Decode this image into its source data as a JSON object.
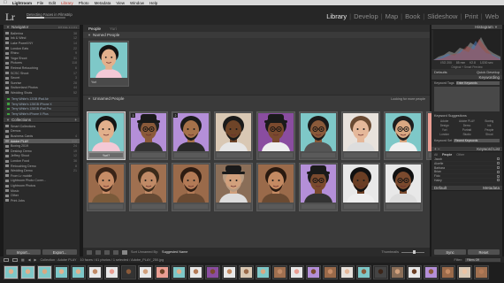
{
  "menubar": {
    "app": "Lightroom",
    "items": [
      "File",
      "Edit",
      "Library",
      "Photo",
      "Metadata",
      "View",
      "Window",
      "Help"
    ],
    "highlight_color": "#c0392b"
  },
  "identity": {
    "logo": "Lr",
    "status": "Detecting Faces in Filmstrip",
    "progress_fraction": 0.45
  },
  "modules": [
    "Library",
    "Develop",
    "Map",
    "Book",
    "Slideshow",
    "Print",
    "Web"
  ],
  "active_module": "Library",
  "left_panel": {
    "navigator_title": "Navigator",
    "navigator_options": "FIT FILL 1:1 3:1",
    "folders": [
      {
        "name": "Ballerina",
        "count": "38"
      },
      {
        "name": "Ink & Wind",
        "count": "12"
      },
      {
        "name": "Lake Powell NY",
        "count": "14"
      },
      {
        "name": "London Eats",
        "count": "22"
      },
      {
        "name": "Rhino",
        "count": "9"
      },
      {
        "name": "Yoga Shoot",
        "count": "31"
      },
      {
        "name": "Pictures",
        "count": "118"
      },
      {
        "name": "Retreat Retouching",
        "count": "6"
      },
      {
        "name": "SCSC Shoot",
        "count": "17"
      },
      {
        "name": "Secret",
        "count": "3"
      },
      {
        "name": "Sunrise",
        "count": "28"
      },
      {
        "name": "Switzerland Photos",
        "count": "44"
      },
      {
        "name": "Wedding Shots",
        "count": "52"
      }
    ],
    "volumes": [
      "Terry White's 12GB iPad Air",
      "Terry White's 128GB iPhone X",
      "Terry White's 128GB iPad Pro",
      "Terry White's iPhone X Plus"
    ],
    "collections_title": "Collections",
    "collections": [
      {
        "name": "Smart Collections",
        "count": "",
        "selected": false
      },
      {
        "name": "Demos",
        "count": "",
        "selected": false
      },
      {
        "name": "Business Cards",
        "count": "4",
        "selected": false
      },
      {
        "name": "Adobe PLAY",
        "count": "310",
        "selected": true
      },
      {
        "name": "Boxing 2019",
        "count": "24",
        "selected": false
      },
      {
        "name": "Desktop Demo",
        "count": "19",
        "selected": false
      },
      {
        "name": "Jeffrey Shoot",
        "count": "12",
        "selected": false
      },
      {
        "name": "London Food",
        "count": "36",
        "selected": false
      },
      {
        "name": "Retouching Demo",
        "count": "8",
        "selected": false
      },
      {
        "name": "Wedding Demo",
        "count": "21",
        "selected": false
      },
      {
        "name": "From Lr mobile",
        "count": "",
        "selected": false
      },
      {
        "name": "Lightroom Photo Cover...",
        "count": "",
        "selected": false
      },
      {
        "name": "Lightroom Photos",
        "count": "",
        "selected": false
      },
      {
        "name": "Music",
        "count": "",
        "selected": false
      },
      {
        "name": "Other",
        "count": "",
        "selected": false
      },
      {
        "name": "Print Jobs",
        "count": "",
        "selected": false
      }
    ],
    "import_label": "Import...",
    "export_label": "Export..."
  },
  "center": {
    "tabs": [
      "People",
      "Yuri"
    ],
    "named_title": "Named People",
    "named_people": [
      {
        "name": "Yuri",
        "skin": "#e2b08c",
        "hair": "#141414",
        "shirt": "#f3c9d6",
        "bg": "#7ec8c8"
      }
    ],
    "unnamed_title": "Unnamed People",
    "unnamed_status": "Looking for more people",
    "faces": [
      {
        "badge": "",
        "label": "Yuri?",
        "bg": "#7ec8c8",
        "skin": "#e2b08c",
        "hair": "#141414",
        "hat": false,
        "shirt": "#f3c9d6",
        "glasses": false,
        "beard": false
      },
      {
        "badge": "3",
        "label": "",
        "bg": "#b48fd8",
        "skin": "#8a5a3a",
        "hair": "#222",
        "hat": true,
        "shirt": "#333",
        "glasses": true,
        "beard": false
      },
      {
        "badge": "2",
        "label": "",
        "bg": "#b48fd8",
        "skin": "#a5714a",
        "hair": "#1a1a1a",
        "hat": false,
        "shirt": "#2a2a2a",
        "glasses": false,
        "beard": true
      },
      {
        "badge": "",
        "label": "",
        "bg": "#d9c8b4",
        "skin": "#6e4428",
        "hair": "#1a1a1a",
        "hat": false,
        "shirt": "#e6e6e6",
        "glasses": false,
        "beard": true
      },
      {
        "badge": "",
        "label": "",
        "bg": "#8a4da0",
        "skin": "#7a4a2e",
        "hair": "#1a1a1a",
        "hat": true,
        "shirt": "#eee",
        "glasses": true,
        "beard": false
      },
      {
        "badge": "",
        "label": "",
        "bg": "#7ec8c8",
        "skin": "#8a5a3a",
        "hair": "#1a1a1a",
        "hat": false,
        "shirt": "#555",
        "glasses": true,
        "beard": true
      },
      {
        "badge": "",
        "label": "",
        "bg": "#e8e2dc",
        "skin": "#e5b89a",
        "hair": "#6a4a32",
        "hat": false,
        "shirt": "#ddd",
        "glasses": false,
        "beard": false
      },
      {
        "badge": "",
        "label": "",
        "bg": "#7ec8c8",
        "skin": "#d9a882",
        "hair": "#1e1e1e",
        "hat": false,
        "shirt": "#f0f0f0",
        "glasses": true,
        "beard": true
      },
      {
        "badge": "",
        "label": "",
        "bg": "#ea9e93",
        "skin": "#edc3a3",
        "hair": "#2a1a14",
        "hat": false,
        "shirt": "#ddd",
        "glasses": false,
        "beard": false
      },
      {
        "badge": "",
        "label": "",
        "bg": "#9a6a4a",
        "skin": "#c78c66",
        "hair": "#3a2418",
        "hat": false,
        "shirt": "#7a5a3a",
        "glasses": false,
        "beard": true
      },
      {
        "badge": "",
        "label": "",
        "bg": "#a07050",
        "skin": "#c08a66",
        "hair": "#3a2a1a",
        "hat": false,
        "shirt": "#664a34",
        "glasses": false,
        "beard": true
      },
      {
        "badge": "",
        "label": "",
        "bg": "#9a6a4a",
        "skin": "#b37a56",
        "hair": "#2e1c12",
        "hat": false,
        "shirt": "#6a4a32",
        "glasses": false,
        "beard": true
      },
      {
        "badge": "",
        "label": "",
        "bg": "#8a6e58",
        "skin": "#d1a07c",
        "hair": "#b89c82",
        "hat": true,
        "shirt": "#ddd",
        "glasses": false,
        "beard": true
      },
      {
        "badge": "",
        "label": "",
        "bg": "#9a6a4a",
        "skin": "#c48a62",
        "hair": "#2a1a10",
        "hat": false,
        "shirt": "#6a4a32",
        "glasses": false,
        "beard": true
      },
      {
        "badge": "",
        "label": "",
        "bg": "#b48fd8",
        "skin": "#7a4a2e",
        "hair": "#1a1a1a",
        "hat": true,
        "shirt": "#333",
        "glasses": true,
        "beard": false
      },
      {
        "badge": "",
        "label": "",
        "bg": "#e8e8e8",
        "skin": "#6a3e24",
        "hair": "#111",
        "hat": false,
        "shirt": "#eee",
        "glasses": false,
        "beard": true
      },
      {
        "badge": "",
        "label": "",
        "bg": "#e8e8e8",
        "skin": "#7a4a2e",
        "hair": "#111",
        "hat": false,
        "shirt": "#ddd",
        "glasses": true,
        "beard": true
      }
    ],
    "sort_label": "Sort Unnamed By:",
    "sort_value": "Suggested Name",
    "thumbnails_label": "Thumbnails",
    "thumb_size_fraction": 0.55
  },
  "right_panel": {
    "histogram_title": "Histogram",
    "histo_info": [
      "ISO 200",
      "85 mm",
      "f/2.8",
      "1/200 sec"
    ],
    "histo_subinfo": "Original + Smart Preview",
    "quick_develop_title": "Quick Develop",
    "quick_develop_preset": "Defaults",
    "keywording_title": "Keywording",
    "keyword_tags_label": "Keyword Tags",
    "keyword_tags_value": "Enter Keywords",
    "keyword_suggestions_title": "Keyword Suggestions",
    "suggestions": [
      "Adobe",
      "Adobe PLAY",
      "Boxing",
      "Design",
      "Demo",
      "Ink",
      "Yuri",
      "Portrait",
      "People",
      "London",
      "Studio",
      "Shoot"
    ],
    "keyword_set_label": "Keyword Set",
    "keyword_set_value": "Recent Keywords",
    "keyword_list_title": "Keyword List",
    "kl_tabs": [
      "All",
      "People",
      "Other"
    ],
    "kl_active_tab": "People",
    "keyword_list": [
      "Jacob",
      "Aloefie",
      "Barbara",
      "Brian",
      "Fido",
      "Haley"
    ],
    "metadata_title": "Metadata",
    "metadata_preset": "Default",
    "sync_label": "Sync",
    "reset_label": "Reset"
  },
  "filmstrip": {
    "page_info": "Collection : Adobe PLAY",
    "count_info": "10 faces / 61 photos / 1 selected / Adobe_PLAY_250.jpg",
    "filter_label": "Filter:",
    "filter_value": "Filters Off",
    "thumbs": [
      {
        "bg": "#7ec8c8",
        "fg": "#e2b08c",
        "selected": true
      },
      {
        "bg": "#7ec8c8",
        "fg": "#e2b08c",
        "selected": true
      },
      {
        "bg": "#7ec8c8",
        "fg": "#d9a882",
        "selected": true
      },
      {
        "bg": "#7ec8c8",
        "fg": "#e2b08c",
        "selected": false
      },
      {
        "bg": "#7ec8c8",
        "fg": "#e2b08c",
        "selected": false
      },
      {
        "bg": "#e8e8e8",
        "fg": "#c08a66",
        "selected": false
      },
      {
        "bg": "#e8e8e8",
        "fg": "#ea9e93",
        "selected": false
      },
      {
        "bg": "#333333",
        "fg": "#8a5a3a",
        "selected": false
      },
      {
        "bg": "#e8e8e8",
        "fg": "#d1a07c",
        "selected": false
      },
      {
        "bg": "#ea9e93",
        "fg": "#6e4428",
        "selected": false
      },
      {
        "bg": "#7ec8c8",
        "fg": "#e2b08c",
        "selected": false
      },
      {
        "bg": "#e8e8e8",
        "fg": "#b37a56",
        "selected": false
      },
      {
        "bg": "#8a4da0",
        "fg": "#7a4a2e",
        "selected": false
      },
      {
        "bg": "#e8e8e8",
        "fg": "#c48a62",
        "selected": false
      },
      {
        "bg": "#d9c8b4",
        "fg": "#9a6a4a",
        "selected": false
      },
      {
        "bg": "#7ec8c8",
        "fg": "#d9a882",
        "selected": false
      },
      {
        "bg": "#a07050",
        "fg": "#c08a66",
        "selected": false
      },
      {
        "bg": "#e8e8e8",
        "fg": "#ea9e93",
        "selected": false
      },
      {
        "bg": "#b48fd8",
        "fg": "#7a4a2e",
        "selected": false
      },
      {
        "bg": "#9a6a4a",
        "fg": "#c78c66",
        "selected": false
      },
      {
        "bg": "#e8e2dc",
        "fg": "#e5b89a",
        "selected": false
      },
      {
        "bg": "#7ec8c8",
        "fg": "#8a5a3a",
        "selected": false
      },
      {
        "bg": "#444444",
        "fg": "#3a2418",
        "selected": false
      },
      {
        "bg": "#8a6e58",
        "fg": "#d1a07c",
        "selected": false
      },
      {
        "bg": "#e8e8e8",
        "fg": "#6a3e24",
        "selected": false
      },
      {
        "bg": "#b48fd8",
        "fg": "#8a5a3a",
        "selected": false
      },
      {
        "bg": "#9a6a4a",
        "fg": "#c48a62",
        "selected": false
      },
      {
        "bg": "#d9c8b4",
        "fg": "#edc3a3",
        "selected": false
      },
      {
        "bg": "#a07050",
        "fg": "#b37a56",
        "selected": false
      }
    ]
  }
}
